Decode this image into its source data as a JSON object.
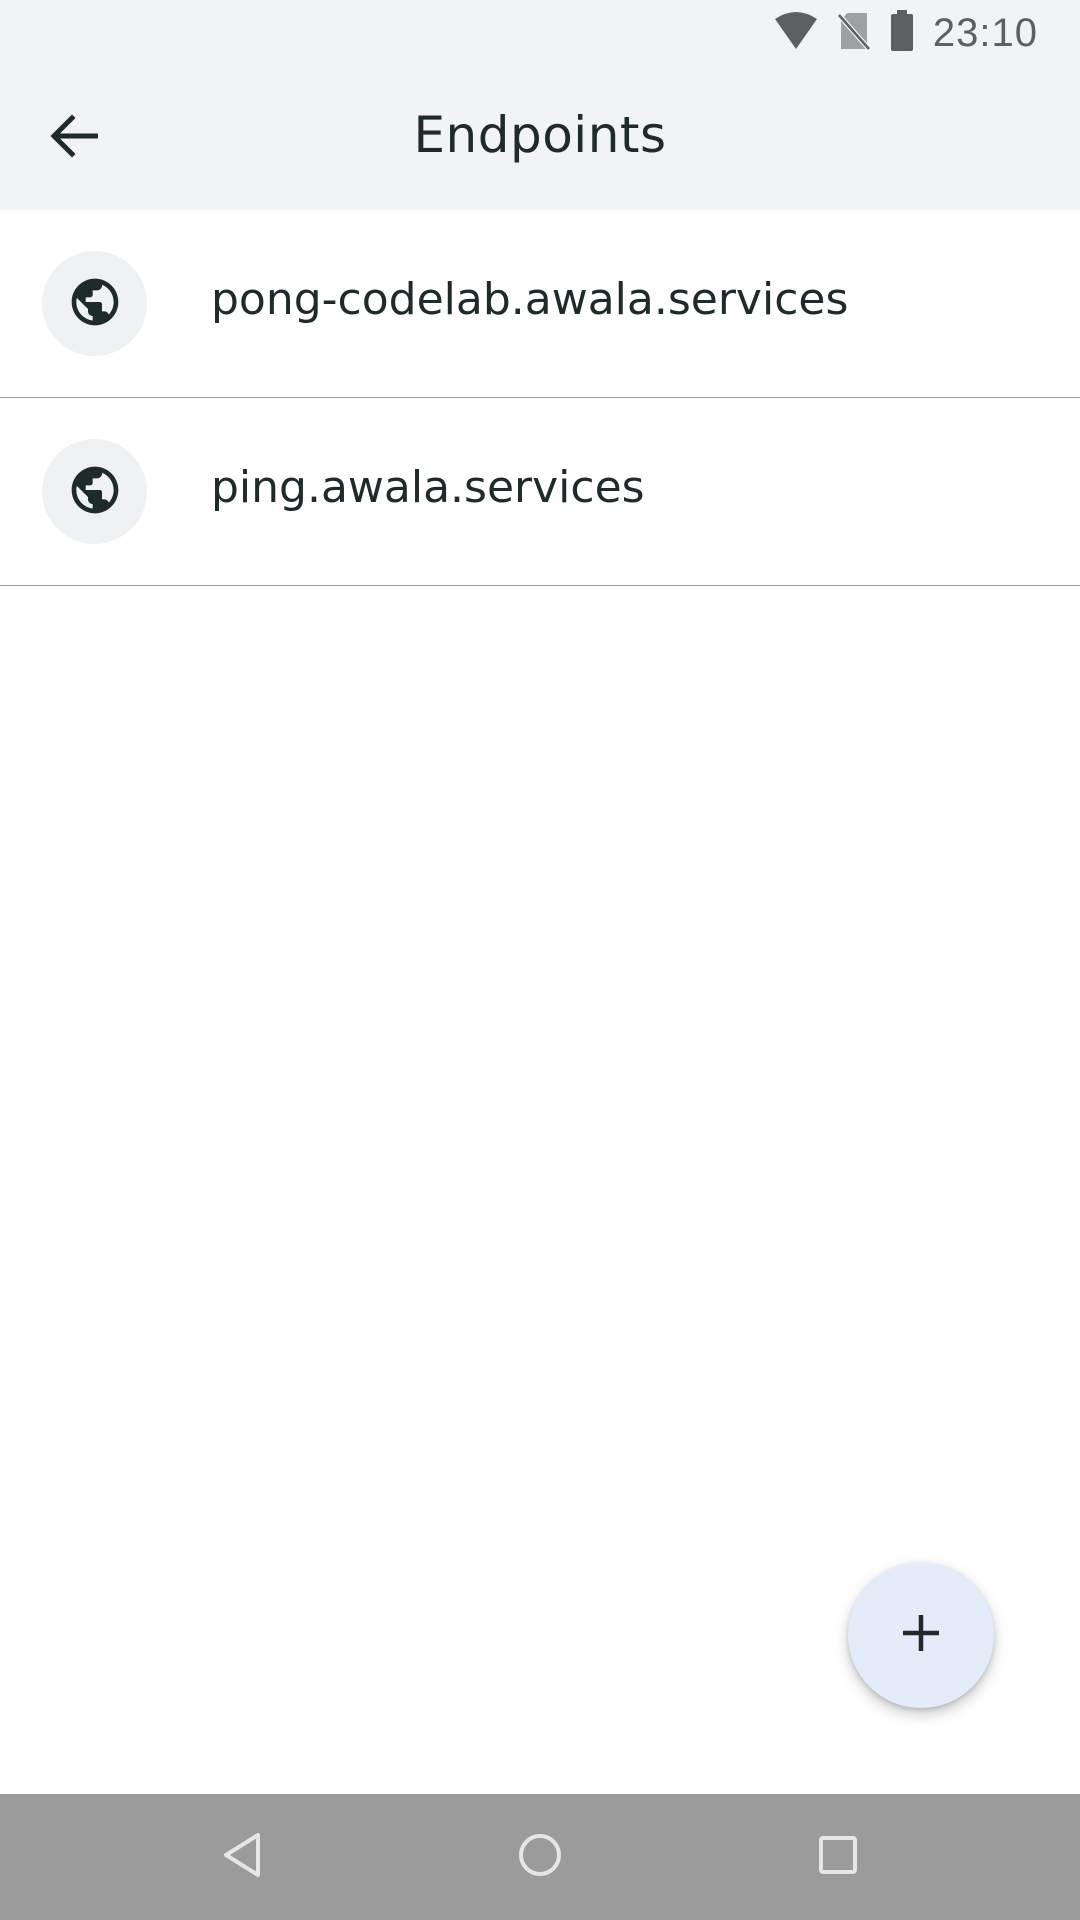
{
  "status_bar": {
    "time": "23:10",
    "icons": [
      "wifi-icon",
      "no-sim-icon",
      "battery-icon"
    ]
  },
  "app_bar": {
    "title": "Endpoints",
    "back_icon": "arrow-back-icon"
  },
  "endpoints": {
    "items": [
      {
        "label": "pong-codelab.awala.services",
        "icon": "globe-icon"
      },
      {
        "label": "ping.awala.services",
        "icon": "globe-icon"
      }
    ]
  },
  "fab": {
    "icon": "plus-icon"
  },
  "nav_bar": {
    "icons": [
      "nav-back-icon",
      "nav-home-icon",
      "nav-recents-icon"
    ]
  },
  "colors": {
    "bar_background": "#f2f3f5",
    "text_primary": "#1f2a2a",
    "fab_background": "#e3ecf8",
    "nav_background": "#9b9b9b",
    "divider": "#9aa0a0"
  }
}
